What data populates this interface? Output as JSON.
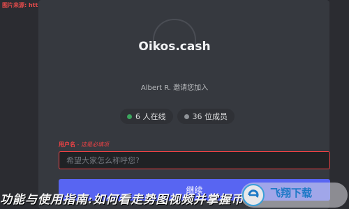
{
  "watermark": "图片来源: http://www.FXXZ.com",
  "server": {
    "name": "Oikos.cash"
  },
  "invite": {
    "text": "Albert R. 邀请您加入"
  },
  "stats": {
    "online": "6 人在线",
    "members": "36 位成员"
  },
  "form": {
    "label": "用户名",
    "required_note": " - 这是必填项",
    "placeholder": "希望大家怎么称呼您?",
    "continue_label": "继续"
  },
  "overlay": {
    "banner_text": "功能与使用指南:如何看走势图视频并掌握币",
    "logo_text": "飞翔下载"
  },
  "colors": {
    "accent": "#5865f2",
    "error": "#ed4245",
    "online": "#3ba55d"
  }
}
